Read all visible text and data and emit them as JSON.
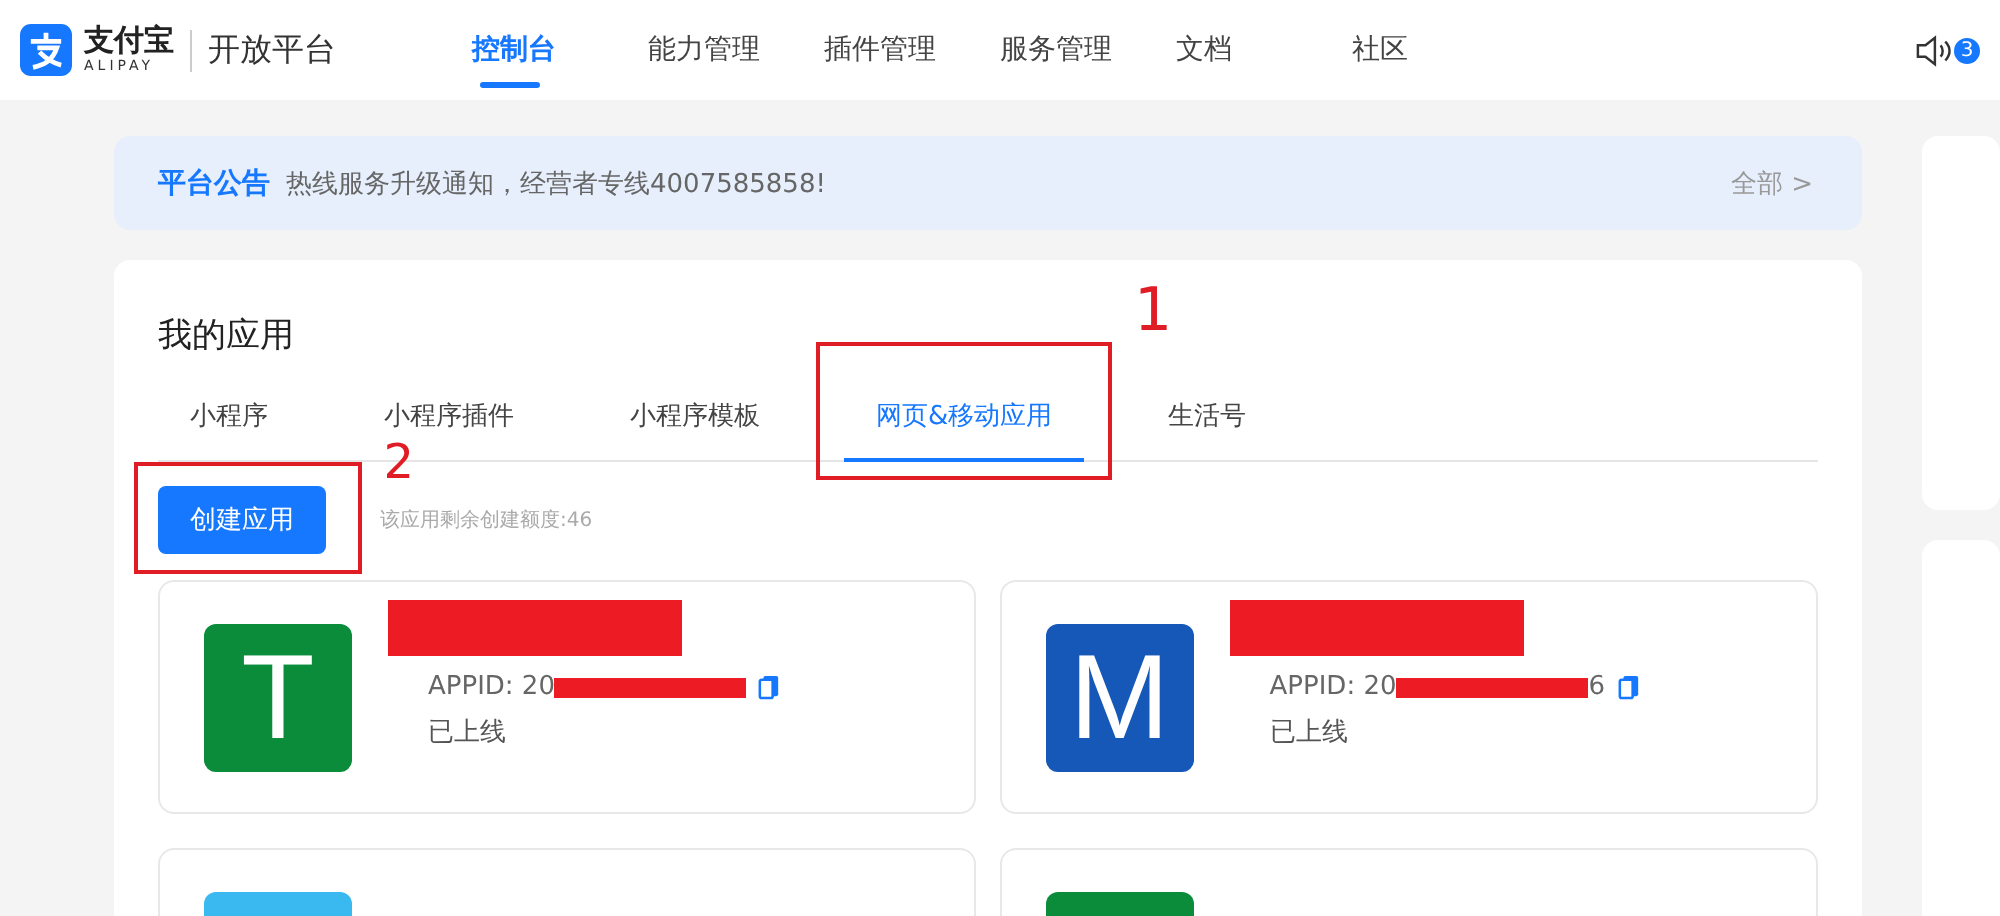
{
  "header": {
    "brand": "支付宝",
    "brand_sub": "ALIPAY",
    "product": "开放平台",
    "nav": [
      {
        "label": "控制台",
        "selected": true
      },
      {
        "label": "能力管理",
        "selected": false
      },
      {
        "label": "插件管理",
        "selected": false
      },
      {
        "label": "服务管理",
        "selected": false
      },
      {
        "label": "文档",
        "selected": false
      },
      {
        "label": "社区",
        "selected": false
      }
    ],
    "notification_count": "3"
  },
  "notice": {
    "label": "平台公告",
    "text": "热线服务升级通知，经营者专线4007585858!",
    "link": "全部 >"
  },
  "apps_panel": {
    "title": "我的应用",
    "tabs": [
      {
        "label": "小程序",
        "selected": false
      },
      {
        "label": "小程序插件",
        "selected": false
      },
      {
        "label": "小程序模板",
        "selected": false
      },
      {
        "label": "网页&移动应用",
        "selected": true,
        "annotation": "1"
      },
      {
        "label": "生活号",
        "selected": false
      }
    ],
    "create_button": {
      "label": "创建应用",
      "annotation": "2"
    },
    "quota": "该应用剩余创建额度:46",
    "apps": [
      {
        "letter": "T",
        "color": "#0a8c3a",
        "appid": "APPID: 20",
        "status": "已上线"
      },
      {
        "letter": "M",
        "color": "#1558b8",
        "appid": "APPID: 20",
        "appid_end": "6",
        "status": "已上线"
      },
      {
        "color": "#3ab8f0"
      },
      {
        "color": "#0a8c3a"
      }
    ]
  }
}
